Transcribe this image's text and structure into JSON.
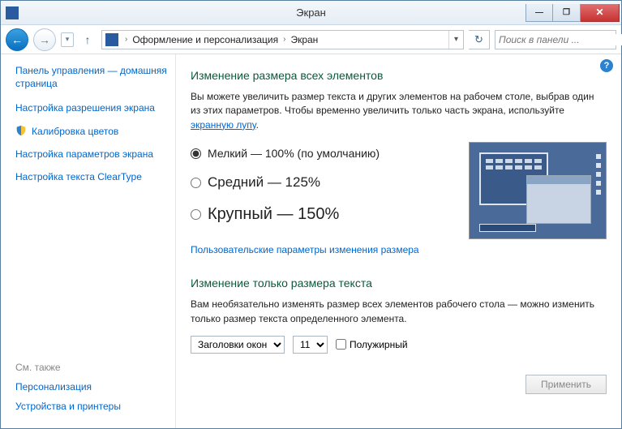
{
  "window": {
    "title": "Экран"
  },
  "winbtns": {
    "min": "—",
    "max": "❐",
    "close": "✕"
  },
  "nav": {
    "back": "←",
    "fwd": "→",
    "recent": "▾",
    "up": "↑",
    "crumb1": "Оформление и персонализация",
    "crumb2": "Экран",
    "sep": "›",
    "refresh": "↻"
  },
  "search": {
    "placeholder": "Поиск в панели ...",
    "icon": "🔍"
  },
  "sidebar": {
    "home": "Панель управления — домашняя страница",
    "links": [
      "Настройка разрешения экрана",
      "Калибровка цветов",
      "Настройка параметров экрана",
      "Настройка текста ClearType"
    ],
    "seealso": "См. также",
    "salinks": [
      "Персонализация",
      "Устройства и принтеры"
    ]
  },
  "content": {
    "help": "?",
    "h1": "Изменение размера всех элементов",
    "p1a": "Вы можете увеличить размер текста и других элементов на рабочем столе, выбрав один из этих параметров. Чтобы временно увеличить только часть экрана, используйте ",
    "p1link": "экранную лупу",
    "p1b": ".",
    "radios": [
      {
        "label": "Мелкий — 100% (по умолчанию)",
        "checked": true
      },
      {
        "label": "Средний — 125%",
        "checked": false
      },
      {
        "label": "Крупный — 150%",
        "checked": false
      }
    ],
    "custom": "Пользовательские параметры изменения размера",
    "h2": "Изменение только размера текста",
    "p2": "Вам необязательно изменять размер всех элементов рабочего стола — можно изменить только размер текста определенного элемента.",
    "elemSelect": "Заголовки окон",
    "sizeSelect": "11",
    "bold": "Полужирный",
    "apply": "Применить"
  }
}
